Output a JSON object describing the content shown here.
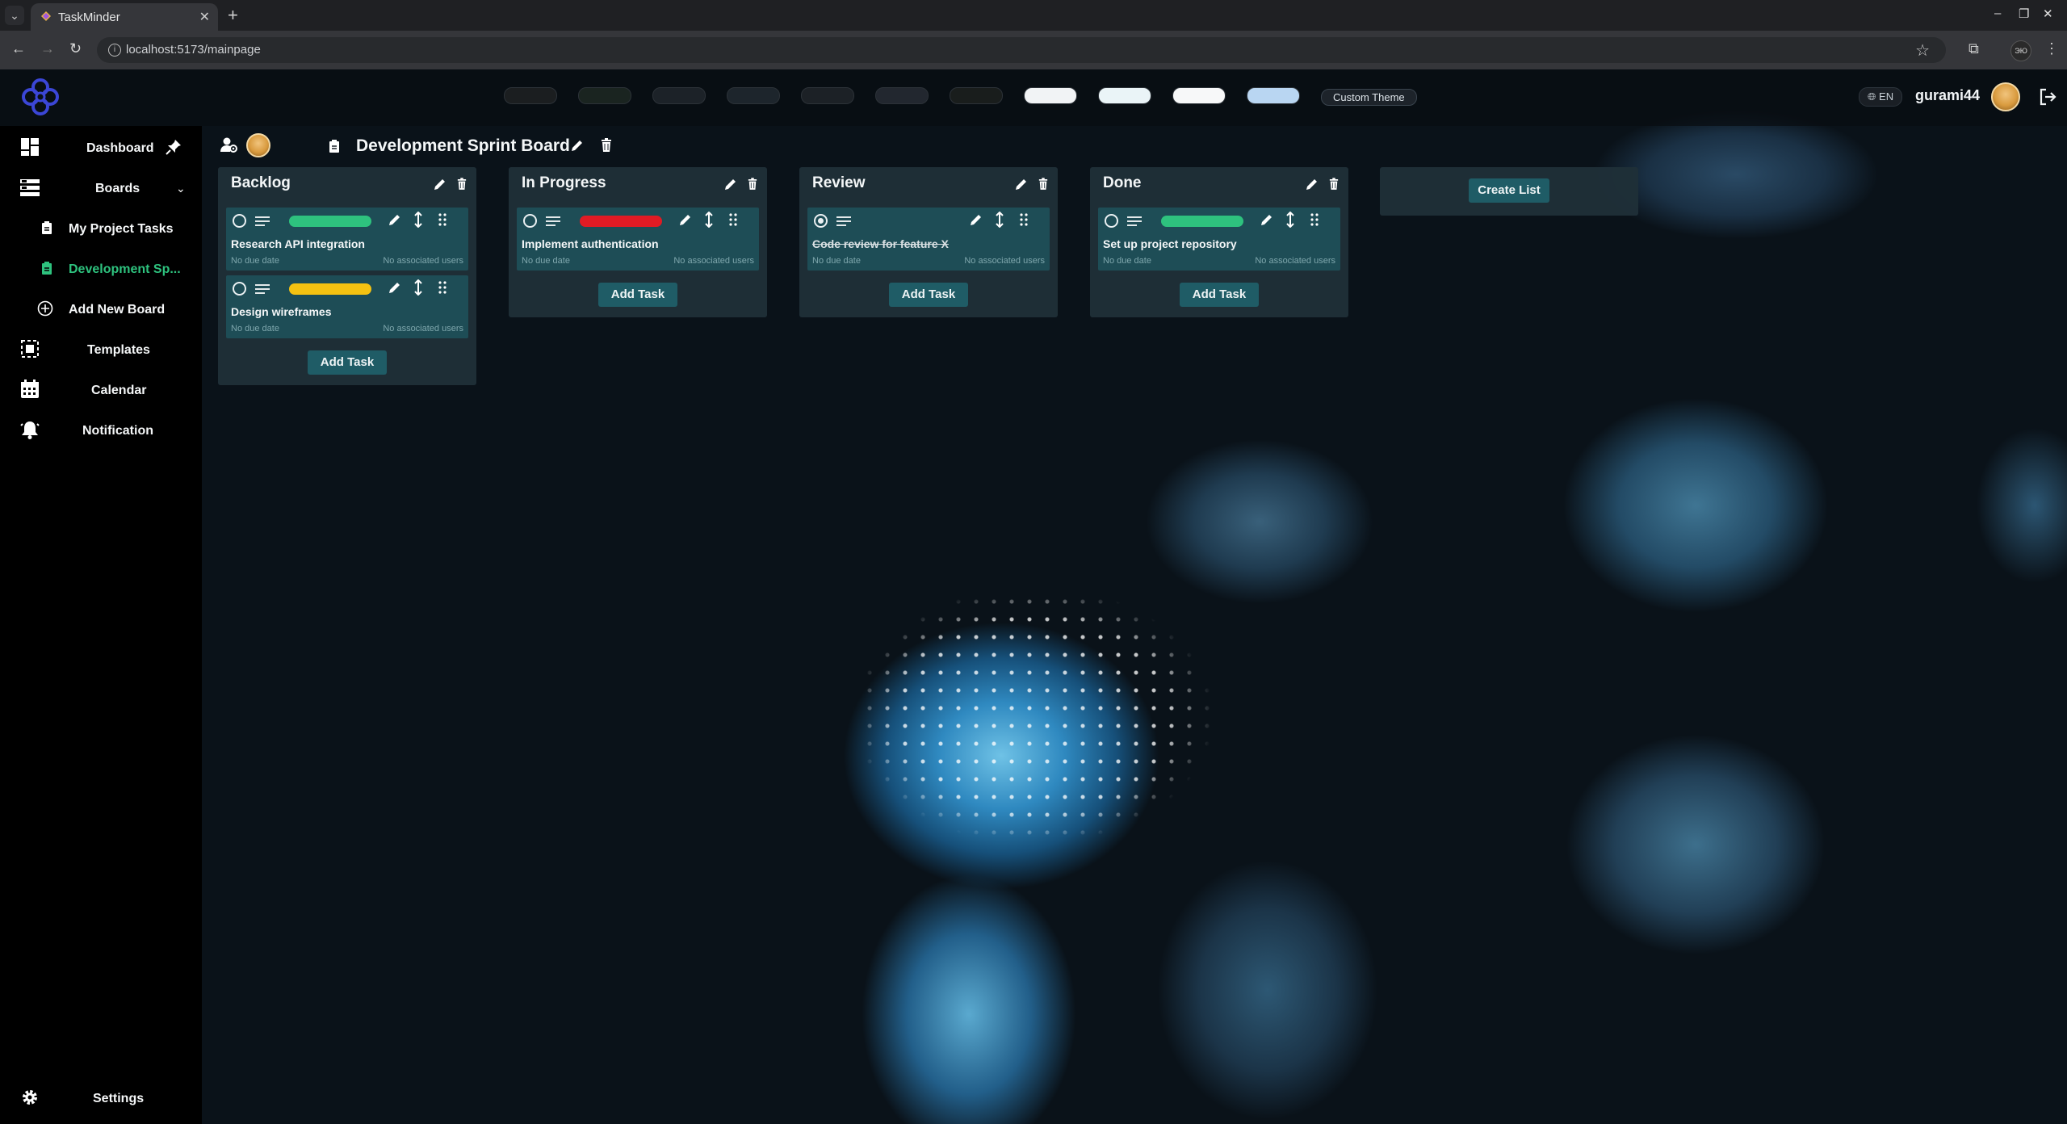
{
  "browser": {
    "tab_title": "TaskMinder",
    "url": "localhost:5173/mainpage",
    "profile_initials": "ЭЮ"
  },
  "header": {
    "theme_swatches": [
      "#1b1e20",
      "#1a2420",
      "#1c2228",
      "#1d252c",
      "#1c2126",
      "#22272f",
      "#191d1c",
      "#f1f3f5",
      "#eaf4f7",
      "#f7f8f9",
      "#b9d6f2"
    ],
    "custom_theme_label": "Custom Theme",
    "language_label": "EN",
    "username": "gurami44"
  },
  "sidebar": {
    "dashboard": "Dashboard",
    "boards": "Boards",
    "board_items": [
      "My Project Tasks",
      "Development Sp..."
    ],
    "add_new_board": "Add New Board",
    "templates": "Templates",
    "calendar": "Calendar",
    "notification": "Notification",
    "settings": "Settings"
  },
  "board": {
    "title": "Development Sprint Board",
    "lists": [
      {
        "title": "Backlog",
        "cards": [
          {
            "title": "Research API integration",
            "priority_color": "#2ec27e",
            "due": "No due date",
            "users": "No associated users",
            "completed": false
          },
          {
            "title": "Design wireframes",
            "priority_color": "#f5c211",
            "due": "No due date",
            "users": "No associated users",
            "completed": false
          }
        ]
      },
      {
        "title": "In Progress",
        "cards": [
          {
            "title": "Implement authentication",
            "priority_color": "#e01b24",
            "due": "No due date",
            "users": "No associated users",
            "completed": false
          }
        ]
      },
      {
        "title": "Review",
        "cards": [
          {
            "title": "Code review for feature X",
            "priority_color": "",
            "due": "No due date",
            "users": "No associated users",
            "completed": true
          }
        ]
      },
      {
        "title": "Done",
        "cards": [
          {
            "title": "Set up project repository",
            "priority_color": "#2ec27e",
            "due": "No due date",
            "users": "No associated users",
            "completed": false
          }
        ]
      }
    ],
    "add_task_label": "Add Task",
    "create_list_label": "Create List"
  }
}
